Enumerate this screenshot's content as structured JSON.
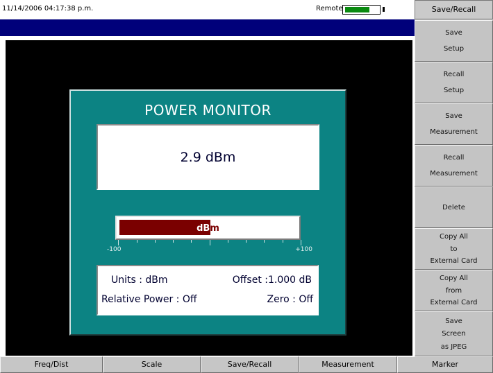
{
  "status": {
    "timestamp": "11/14/2006 04:17:38 p.m.",
    "remote_label": "Remote",
    "battery_level": 0.75,
    "battery_color": "#0a8a10"
  },
  "power_monitor": {
    "title": "POWER MONITOR",
    "reading": "2.9 dBm",
    "bar": {
      "label": "dBm",
      "scale_min": "-100",
      "scale_max": "+100",
      "value": 2.9,
      "fill_color": "#7a0000"
    },
    "info": {
      "units": "Units : dBm",
      "offset": "Offset :1.000 dB",
      "relative_power": "Relative Power : Off",
      "zero": "Zero :  Off"
    },
    "panel_color": "#0c8383"
  },
  "sidebar": {
    "title": "Save/Recall",
    "keys": [
      {
        "line1": "Save",
        "line2": "Setup"
      },
      {
        "line1": "Recall",
        "line2": "Setup"
      },
      {
        "line1": "Save",
        "line2": "Measurement"
      },
      {
        "line1": "Recall",
        "line2": "Measurement"
      },
      {
        "line1": "Delete"
      },
      {
        "line1": "Copy All",
        "line2": "to",
        "line3": "External Card"
      },
      {
        "line1": "Copy All",
        "line2": "from",
        "line3": "External Card"
      },
      {
        "line1": "Save",
        "line2": "Screen",
        "line3": "as JPEG"
      }
    ]
  },
  "bottom_menu": [
    "Freq/Dist",
    "Scale",
    "Save/Recall",
    "Measurement",
    "Marker"
  ]
}
